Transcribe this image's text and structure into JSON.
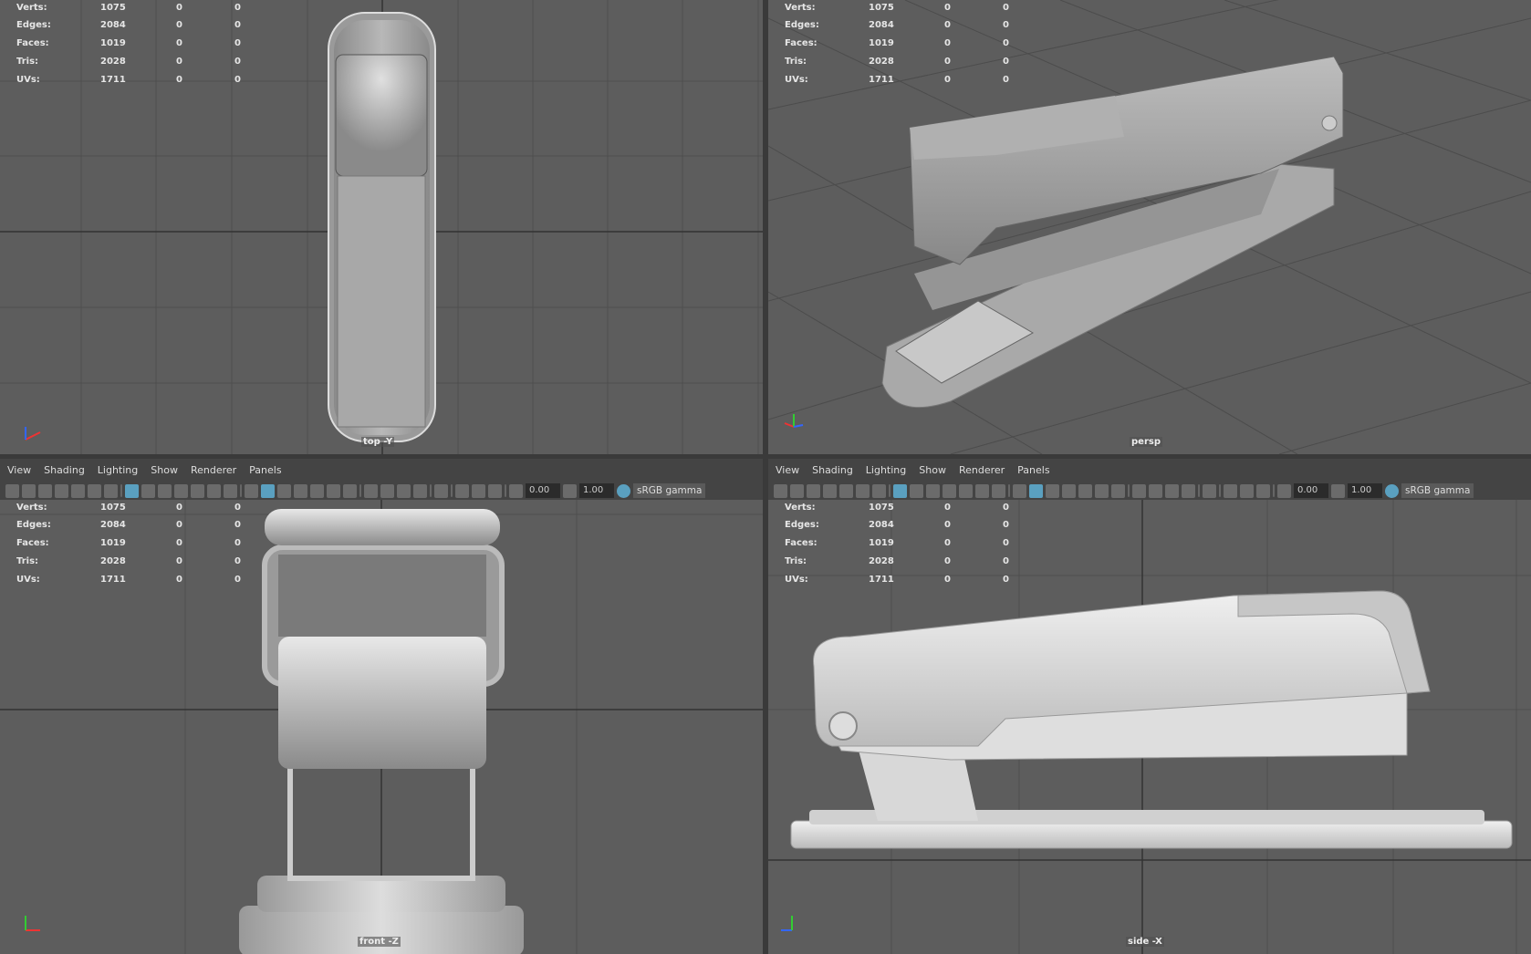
{
  "stats": {
    "labels": [
      "Verts:",
      "Edges:",
      "Faces:",
      "Tris:",
      "UVs:"
    ],
    "values": [
      "1075",
      "2084",
      "1019",
      "2028",
      "1711"
    ],
    "selected": [
      "0",
      "0",
      "0",
      "0",
      "0"
    ],
    "extra": [
      "0",
      "0",
      "0",
      "0",
      "0"
    ]
  },
  "viewports": [
    {
      "camera": "top -Y"
    },
    {
      "camera": "persp"
    },
    {
      "camera": "front -Z"
    },
    {
      "camera": "side -X"
    }
  ],
  "menu": [
    "View",
    "Shading",
    "Lighting",
    "Show",
    "Renderer",
    "Panels"
  ],
  "toolbar": {
    "icons": [
      "select-camera-icon",
      "camera-attributes-icon",
      "bookmark-camera-icon",
      "bookmark-icon",
      "image-plane-icon",
      "2d-pan-zoom-icon",
      "grease-pencil-icon",
      "sep",
      "grid-icon",
      "film-gate-icon",
      "resolution-gate-icon",
      "gate-mask-icon",
      "field-chart-icon",
      "safe-action-icon",
      "safe-title-icon",
      "sep",
      "wireframe-icon",
      "smooth-shade-icon",
      "default-material-icon",
      "wireframe-on-shaded-icon",
      "textured-icon",
      "lights-icon",
      "shadows-icon",
      "sep",
      "screen-space-ao-icon",
      "motion-blur-icon",
      "multisample-aa-icon",
      "depth-of-field-icon",
      "sep",
      "isolate-select-icon",
      "sep",
      "xray-icon",
      "xray-joints-icon",
      "backface-culling-icon",
      "sep",
      "exposure-icon"
    ],
    "exposure": "0.00",
    "gamma_icon": "gamma-icon",
    "gamma": "1.00",
    "color_mgmt_icon": "color-management-icon",
    "color_space": "sRGB gamma"
  },
  "colors": {
    "viewport_bg": "#5d5d5d",
    "accent": "#5aa0c0"
  }
}
